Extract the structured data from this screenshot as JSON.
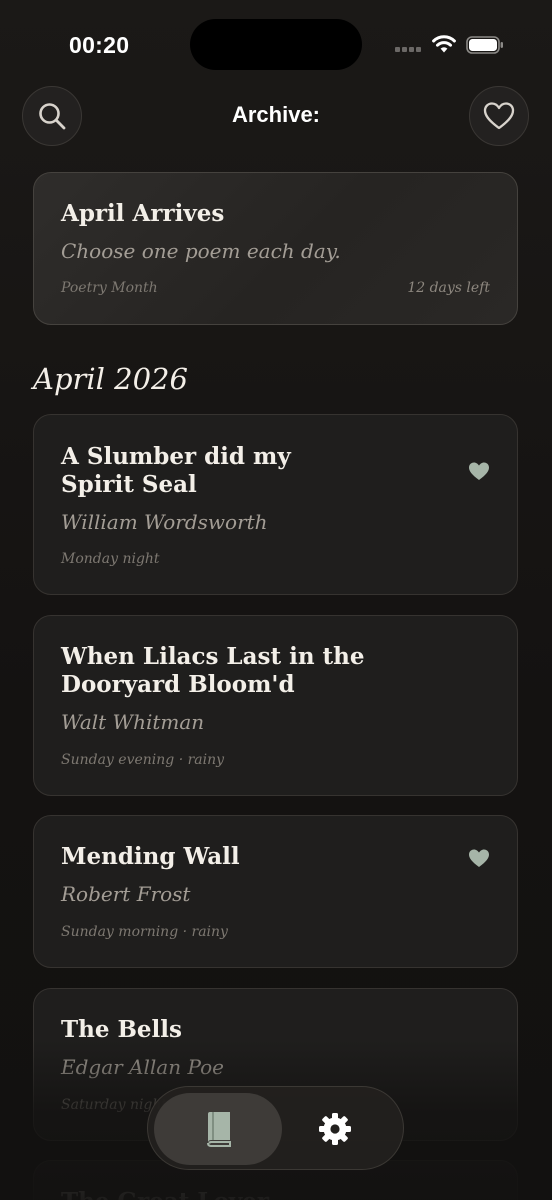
{
  "status_bar": {
    "time": "00:20"
  },
  "header": {
    "title": "Archive:",
    "search_icon": "search-icon",
    "favorites_icon": "heart-outline-icon"
  },
  "promo": {
    "title": "April Arrives",
    "subtitle": "Choose one poem each day.",
    "tag": "Poetry Month",
    "remaining": "12 days left"
  },
  "section": {
    "title": "April 2026"
  },
  "poems": [
    {
      "title_line1": "A Slumber did my",
      "title_line2": "Spirit Seal",
      "author": "William Wordsworth",
      "meta": "Monday night",
      "favorited": true
    },
    {
      "title_line1": "When Lilacs Last in the",
      "title_line2": "Dooryard Bloom'd",
      "author": "Walt Whitman",
      "meta": "Sunday evening · rainy",
      "favorited": false
    },
    {
      "title_line1": "Mending Wall",
      "author": "Robert Frost",
      "meta": "Sunday morning · rainy",
      "favorited": true
    },
    {
      "title_line1": "The Bells",
      "author": "Edgar Allan Poe",
      "meta": "Saturday night",
      "favorited": false
    },
    {
      "title_line1": "The Great Lover",
      "author": "",
      "meta": "",
      "favorited": false
    }
  ],
  "tab_bar": {
    "tabs": [
      {
        "name": "library",
        "icon": "book-icon",
        "selected": true
      },
      {
        "name": "settings",
        "icon": "gear-icon",
        "selected": false
      }
    ]
  },
  "colors": {
    "background": "#161412",
    "card": "#1f1e1d",
    "accent_heart": "#a6b5a8",
    "text_primary": "#f3efe8",
    "text_secondary": "#a39d95"
  }
}
